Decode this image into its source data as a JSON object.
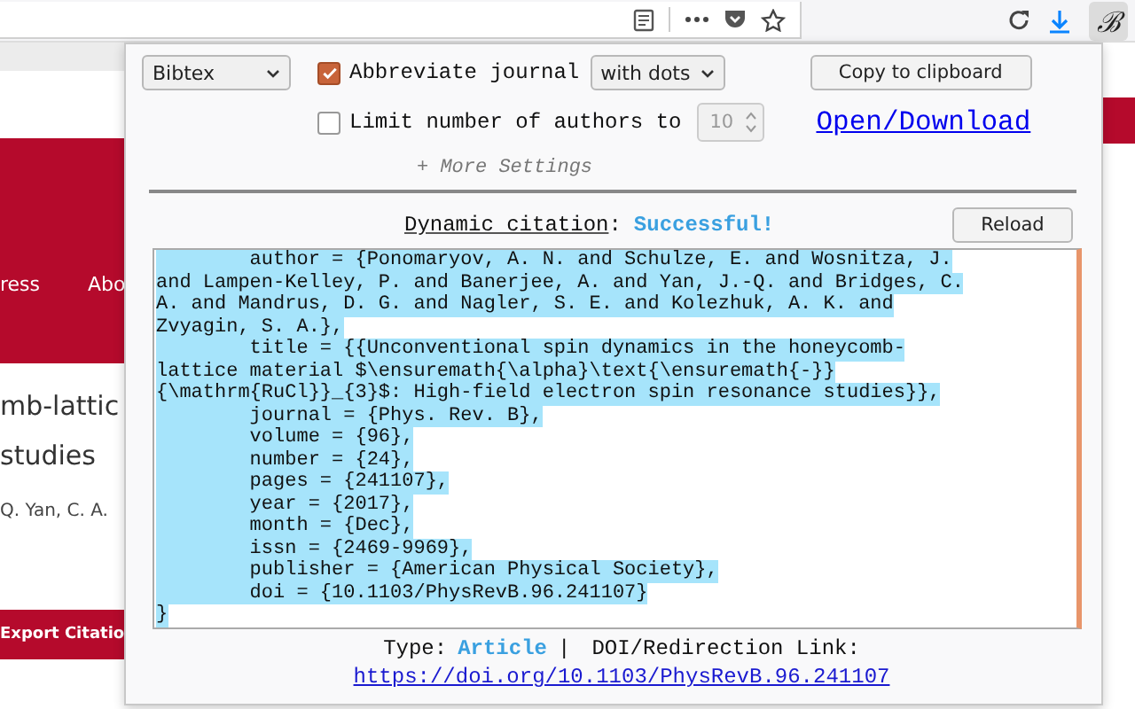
{
  "toolbar": {
    "extension_button": "ℬ"
  },
  "page": {
    "nav": [
      "ress",
      "Abo"
    ],
    "title_lines": [
      "mb-lattic",
      "studies"
    ],
    "authors": "Q. Yan, C. A.",
    "export_button": "Export Citatio"
  },
  "popup": {
    "format_select": "Bibtex",
    "abbreviate": {
      "label": "Abbreviate journal",
      "checked": true
    },
    "abbreviate_select": "with dots",
    "copy_button": "Copy to clipboard",
    "limit": {
      "label": "Limit number of authors to",
      "checked": false,
      "value": "10"
    },
    "open_link": "Open/Download",
    "more_settings": "+ More Settings",
    "dynamic_label": "Dynamic citation",
    "dynamic_colon": ":",
    "dynamic_status": "Successful!",
    "reload_button": "Reload",
    "citation_lines": [
      "        author = {Ponomaryov, A. N. and Schulze, E. and Wosnitza, J.",
      "and Lampen-Kelley, P. and Banerjee, A. and Yan, J.-Q. and Bridges, C.",
      "A. and Mandrus, D. G. and Nagler, S. E. and Kolezhuk, A. K. and",
      "Zvyagin, S. A.},",
      "        title = {{Unconventional spin dynamics in the honeycomb-",
      "lattice material $\\ensuremath{\\alpha}\\text{\\ensuremath{-}}",
      "{\\mathrm{RuCl}}_{3}$: High-field electron spin resonance studies}},",
      "        journal = {Phys. Rev. B},",
      "        volume = {96},",
      "        number = {24},",
      "        pages = {241107},",
      "        year = {2017},",
      "        month = {Dec},",
      "        issn = {2469-9969},",
      "        publisher = {American Physical Society},",
      "        doi = {10.1103/PhysRevB.96.241107}",
      "}"
    ],
    "type_label": "Type:",
    "type_value": "Article",
    "separator": "|",
    "doi_label": "DOI/Redirection Link:",
    "doi_url": "https://doi.org/10.1103/PhysRevB.96.241107"
  }
}
